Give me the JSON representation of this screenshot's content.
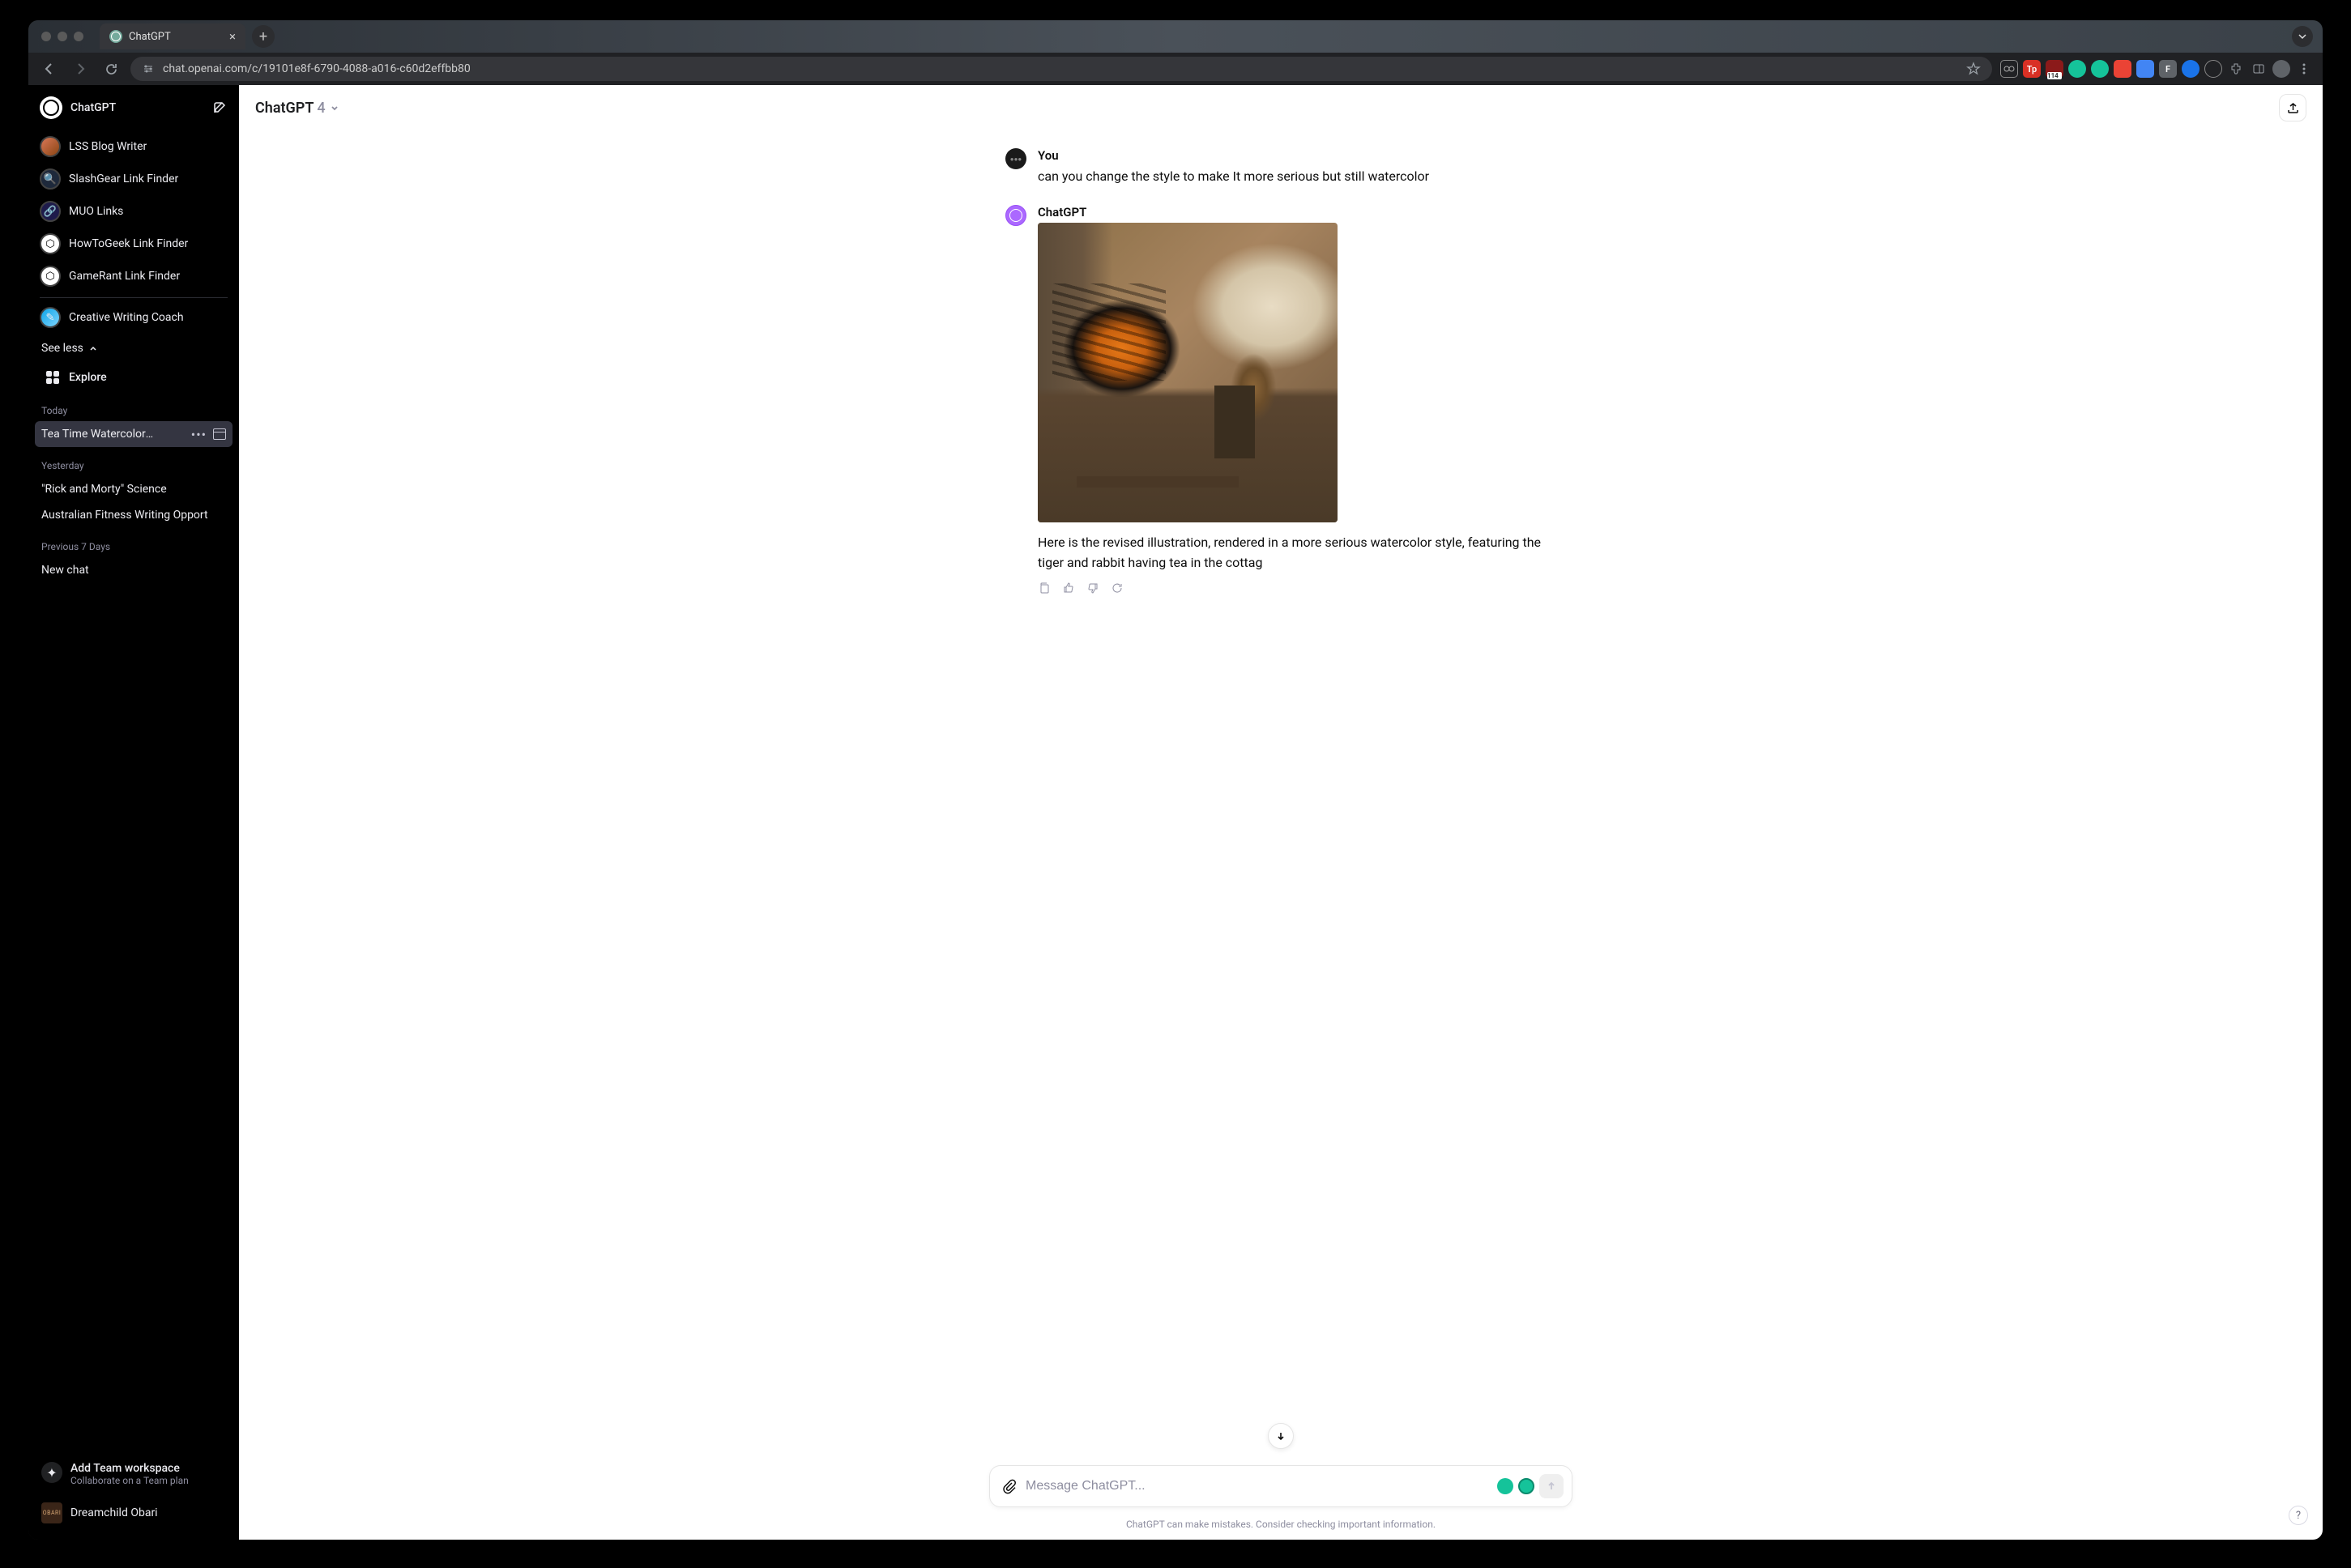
{
  "browser": {
    "tab_title": "ChatGPT",
    "url_display": "chat.openai.com/c/19101e8f-6790-4088-a016-c60d2effbb80",
    "extension_badge": "114"
  },
  "sidebar": {
    "brand": "ChatGPT",
    "gpts": [
      {
        "label": "LSS Blog Writer",
        "color": "#d97757"
      },
      {
        "label": "SlashGear Link Finder",
        "color": "#2563eb"
      },
      {
        "label": "MUO Links",
        "color": "#7c3aed"
      },
      {
        "label": "HowToGeek Link Finder",
        "color": "#ffffff"
      },
      {
        "label": "GameRant Link Finder",
        "color": "#ffffff"
      },
      {
        "label": "Creative Writing Coach",
        "color": "#0ea5e9"
      }
    ],
    "see_less": "See less",
    "explore": "Explore",
    "sections": [
      {
        "label": "Today",
        "chats": [
          {
            "title": "Tea Time Watercolor Illust",
            "active": true
          }
        ]
      },
      {
        "label": "Yesterday",
        "chats": [
          {
            "title": "\"Rick and Morty\" Science"
          },
          {
            "title": "Australian Fitness Writing Opport"
          }
        ]
      },
      {
        "label": "Previous 7 Days",
        "chats": [
          {
            "title": "New chat"
          }
        ]
      }
    ],
    "team": {
      "title": "Add Team workspace",
      "subtitle": "Collaborate on a Team plan"
    },
    "user": {
      "name": "Dreamchild Obari"
    }
  },
  "main": {
    "model_name": "ChatGPT",
    "model_version": "4",
    "messages": {
      "user_author": "You",
      "user_text": "can you change the style to make It more serious but still watercolor",
      "assistant_author": "ChatGPT",
      "assistant_text": "Here is the revised illustration, rendered in a more serious watercolor style, featuring the tiger and rabbit having tea in the cottag"
    },
    "composer_placeholder": "Message ChatGPT...",
    "disclaimer": "ChatGPT can make mistakes. Consider checking important information."
  }
}
